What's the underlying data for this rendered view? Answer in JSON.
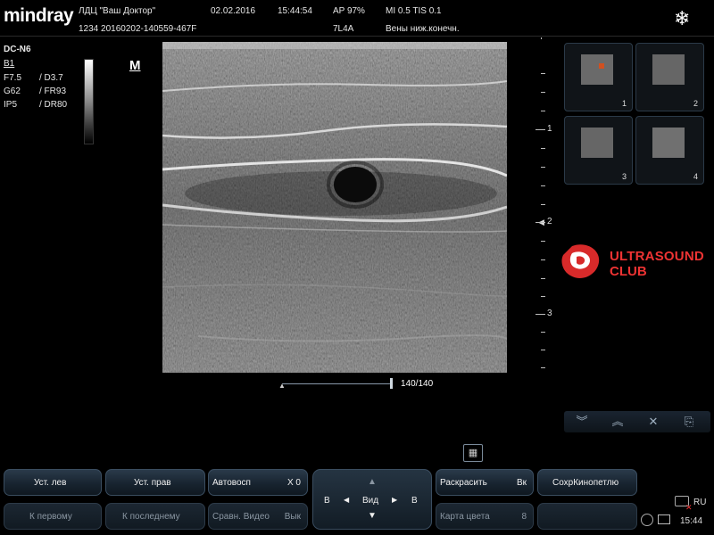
{
  "header": {
    "logo": "mindray",
    "clinic": "ЛДЦ \"Ваш Доктор\"",
    "patient_id": "1234 20160202-140559-467F",
    "date": "02.02.2016",
    "time": "15:44:54",
    "ap": "AP  97%",
    "mi_tis": "MI 0.5  TIS 0.1",
    "probe": "7L4A",
    "exam": "Вены ниж.конечн."
  },
  "params": {
    "mode": "DC-N6",
    "b_mode": "B1",
    "freq": "F7.5",
    "depth": "/ D3.7",
    "gain": "G62",
    "frame_rate": "/ FR93",
    "ip": "IP5",
    "dynamic_range": "/ DR80",
    "m_mark": "M"
  },
  "depth_scale": {
    "labels": [
      "1",
      "2",
      "3"
    ]
  },
  "thumbnails": [
    {
      "num": "1"
    },
    {
      "num": "2"
    },
    {
      "num": "3"
    },
    {
      "num": "4"
    }
  ],
  "club": {
    "line1": "ULTRASOUND",
    "line2": "CLUB"
  },
  "cine": {
    "frame": "140/140"
  },
  "tools": {
    "icons": [
      "chevrons-down-icon",
      "chevrons-up-icon",
      "close-icon",
      "export-icon"
    ]
  },
  "buttons": {
    "row1": {
      "ust_lev": "Уст. лев",
      "ust_prav": "Уст. прав",
      "avtovosp": "Автовосп",
      "avtovosp_val": "X 0",
      "raskrasit": "Раскрасить",
      "raskrasit_val": "Вк",
      "sohr": "СохрКинопетлю"
    },
    "row2": {
      "k_pervomu": "К первому",
      "k_poslednemu": "К последнему",
      "sravn": "Сравн. Видео",
      "sravn_val": "Вык",
      "karta": "Карта цвета",
      "karta_val": "8"
    },
    "view_pad": {
      "center": "Вид",
      "left_b": "B",
      "right_b": "B"
    }
  },
  "status": {
    "lang": "RU",
    "clock": "15:44"
  },
  "colors": {
    "brand_red": "#e33333",
    "button_bg": "#1c2a38"
  }
}
